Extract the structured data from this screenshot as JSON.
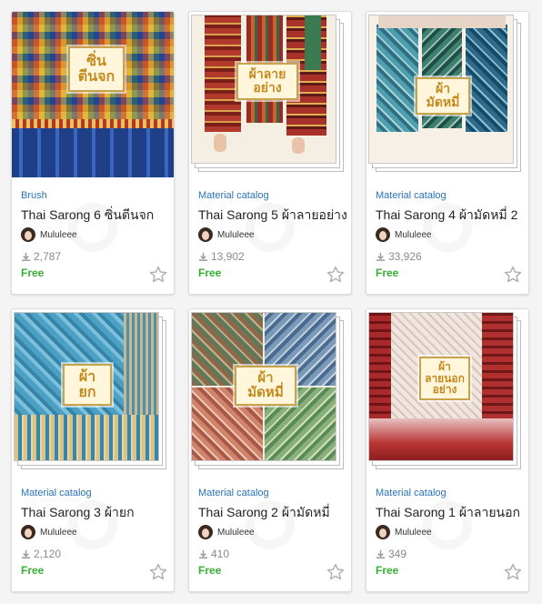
{
  "cards": [
    {
      "category": "Brush",
      "title": "Thai Sarong 6 ซิ่นตีนจก",
      "author": "Mululeee",
      "downloads": "2,787",
      "price": "Free",
      "label_lines": [
        "ซิ่น",
        "ตีนจก"
      ],
      "thumb_style": "single"
    },
    {
      "category": "Material catalog",
      "title": "Thai Sarong 5 ผ้าลายอย่าง",
      "author": "Mululeee",
      "downloads": "13,902",
      "price": "Free",
      "label_lines": [
        "ผ้าลาย",
        "อย่าง"
      ],
      "thumb_style": "stack"
    },
    {
      "category": "Material catalog",
      "title": "Thai Sarong 4 ผ้ามัดหมี่ 2",
      "author": "Mululeee",
      "downloads": "33,926",
      "price": "Free",
      "label_lines": [
        "ผ้า",
        "มัดหมี่"
      ],
      "thumb_style": "stack"
    },
    {
      "category": "Material catalog",
      "title": "Thai Sarong 3 ผ้ายก",
      "author": "Mululeee",
      "downloads": "2,120",
      "price": "Free",
      "label_lines": [
        "ผ้า",
        "ยก"
      ],
      "thumb_style": "stack"
    },
    {
      "category": "Material catalog",
      "title": "Thai Sarong 2 ผ้ามัดหมี่",
      "author": "Mululeee",
      "downloads": "410",
      "price": "Free",
      "label_lines": [
        "ผ้า",
        "มัดหมี่"
      ],
      "thumb_style": "stack"
    },
    {
      "category": "Material catalog",
      "title": "Thai Sarong 1 ผ้าลายนอก",
      "author": "Mululeee",
      "downloads": "349",
      "price": "Free",
      "label_lines": [
        "ผ้า",
        "ลายนอก",
        "อย่าง"
      ],
      "thumb_style": "stack"
    }
  ],
  "icons": {
    "download": "download-icon",
    "favorite": "star-outline-icon",
    "avatar": "user-avatar"
  },
  "colors": {
    "category": "#2a72b8",
    "price": "#36b032",
    "label_border": "#c9a24a",
    "label_text": "#c58a1e"
  }
}
